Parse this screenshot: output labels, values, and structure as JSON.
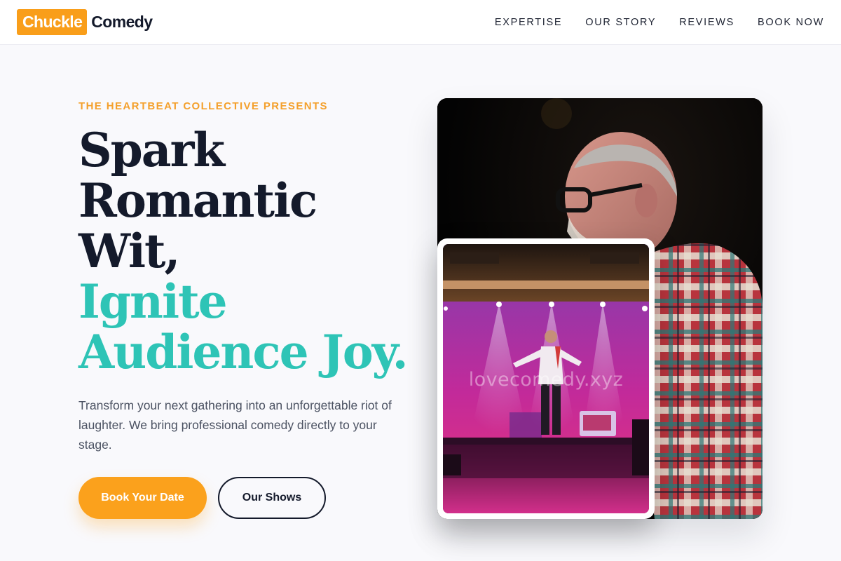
{
  "brand": {
    "highlight": "Chuckle",
    "word": "Comedy",
    "accent_color": "#f99e1a"
  },
  "nav": {
    "links": [
      {
        "label": "EXPERTISE"
      },
      {
        "label": "OUR STORY"
      },
      {
        "label": "REVIEWS"
      },
      {
        "label": "BOOK NOW"
      }
    ]
  },
  "hero": {
    "eyebrow": "THE HEARTBEAT COLLECTIVE PRESENTS",
    "headline_dark": [
      "Spark",
      "Romantic",
      "Wit,"
    ],
    "headline_teal": [
      "Ignite",
      "Audience Joy."
    ],
    "teal_color": "#2ec4b6",
    "lede": "Transform your next gathering into an unforgettable riot of laughter. We bring professional comedy directly to your stage.",
    "primary_cta": "Book Your Date",
    "secondary_cta": "Our Shows"
  },
  "images": {
    "main": {
      "subject": "comedian-portrait"
    },
    "inset": {
      "subject": "stage-performance",
      "watermark": "lovecomedy.xyz"
    }
  }
}
